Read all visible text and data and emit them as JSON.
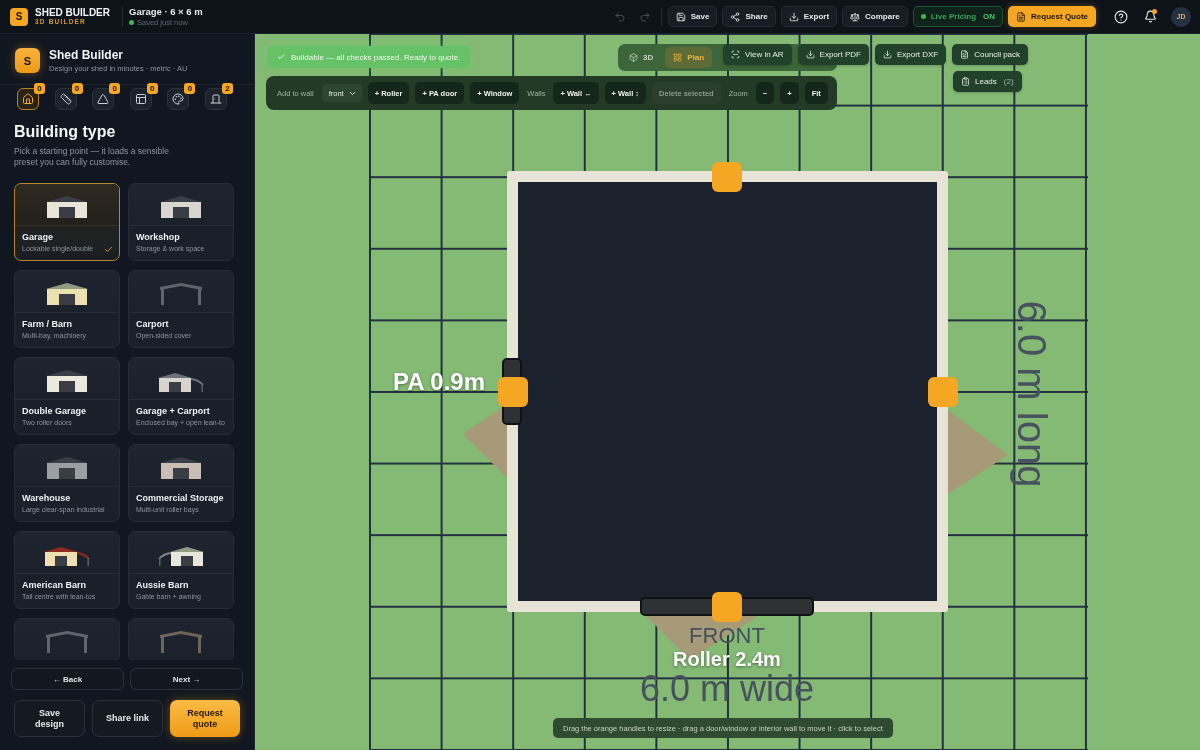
{
  "topbar": {
    "brand": {
      "logo_letter": "S",
      "name": "SHED BUILDER",
      "tagline": "3D BUILDER"
    },
    "project": {
      "title": "Garage · 6 × 6 m",
      "status": "Saved just now",
      "saved": true
    },
    "history": [
      {
        "kind": "undo",
        "disabled": true
      },
      {
        "kind": "redo",
        "disabled": true
      }
    ],
    "actions": [
      {
        "kind": "save",
        "label": "Save"
      },
      {
        "kind": "share",
        "label": "Share"
      },
      {
        "kind": "export",
        "label": "Export"
      },
      {
        "kind": "compare",
        "label": "Compare"
      }
    ],
    "live_pricing": {
      "label": "Live Pricing",
      "state": "ON",
      "on": true
    },
    "quote_button": {
      "label": "Request Quote"
    },
    "notifications": {
      "unread": true
    },
    "avatar": {
      "initials": "JD"
    }
  },
  "sidebar": {
    "logo_letter": "S",
    "title": "Shed Builder",
    "subtitle": "Design your shed in minutes · metric · AU",
    "steps": [
      {
        "kind": "home",
        "badge": "0",
        "selected": true
      },
      {
        "kind": "ruler",
        "badge": "0",
        "selected": false
      },
      {
        "kind": "triangle",
        "badge": "0",
        "selected": false
      },
      {
        "kind": "panel",
        "badge": "0",
        "selected": false
      },
      {
        "kind": "palette",
        "badge": "0",
        "selected": false
      },
      {
        "kind": "door",
        "badge": "2",
        "selected": false
      }
    ],
    "section_title": "Building type",
    "section_description": "Pick a starting point — it loads a sensible preset you can fully customise.",
    "building_types": [
      {
        "name": "Garage",
        "description": "Lockable single/double",
        "kind": "gable",
        "color": "#e8e4d8",
        "selected": true
      },
      {
        "name": "Workshop",
        "description": "Storage & work space",
        "kind": "gable",
        "color": "#d8d6cf",
        "selected": false
      },
      {
        "name": "Farm / Barn",
        "description": "Multi-bay, machinery",
        "kind": "farm",
        "color": "#ebe0b0",
        "selected": false
      },
      {
        "name": "Carport",
        "description": "Open-sided cover",
        "kind": "open",
        "color": "#60656c",
        "selected": false
      },
      {
        "name": "Double Garage",
        "description": "Two roller doors",
        "kind": "gable",
        "color": "#ebe8dd",
        "selected": false
      },
      {
        "name": "Garage + Carport",
        "description": "Enclosed bay + open lean-to",
        "kind": "leanto",
        "color": "#d6d4cc",
        "selected": false
      },
      {
        "name": "Warehouse",
        "description": "Large clear-span industrial",
        "kind": "gable",
        "color": "#9b9fa4",
        "selected": false
      },
      {
        "name": "Commercial Storage",
        "description": "Multi-unit roller bays",
        "kind": "gable",
        "color": "#c9beb5",
        "selected": false
      },
      {
        "name": "American Barn",
        "description": "Tall centre with lean-tos",
        "kind": "barn",
        "color": "#eedeb2",
        "selected": false
      },
      {
        "name": "Aussie Barn",
        "description": "Gable barn + awning",
        "kind": "awning",
        "color": "#e9e6dc",
        "selected": false
      },
      {
        "kind": "open",
        "color": "#60656c",
        "selected": false
      },
      {
        "kind": "open",
        "color": "#6e6458",
        "selected": false
      }
    ],
    "nav": [
      {
        "label": "← Back"
      },
      {
        "label": "Next →"
      }
    ],
    "footer_buttons": [
      {
        "label": "Save design",
        "kind": "secondary"
      },
      {
        "label": "Share link",
        "kind": "secondary"
      },
      {
        "label": "Request quote",
        "kind": "primary"
      }
    ]
  },
  "canvas": {
    "status": {
      "text": "Buildable — all checks passed. Ready to quote.",
      "ok": true
    },
    "view_modes": [
      {
        "kind": "cube",
        "label": "3D",
        "selected": false
      },
      {
        "kind": "grid",
        "label": "Plan",
        "selected": true
      }
    ],
    "export_buttons": [
      {
        "kind": "ar",
        "label": "View in AR"
      },
      {
        "kind": "pdf",
        "label": "Export PDF"
      },
      {
        "kind": "dxf",
        "label": "Export DXF"
      },
      {
        "kind": "document",
        "label": "Council pack"
      }
    ],
    "leads_button": {
      "label": "Leads",
      "count": "(2)"
    },
    "toolbar": [
      {
        "kind": "label",
        "text": "Add to wall"
      },
      {
        "kind": "select",
        "value": "front"
      },
      {
        "kind": "button",
        "text": "+ Roller",
        "disabled": false
      },
      {
        "kind": "button",
        "text": "+ PA door",
        "disabled": false
      },
      {
        "kind": "button",
        "text": "+ Window",
        "disabled": false
      },
      {
        "kind": "label",
        "text": "Walls"
      },
      {
        "kind": "button",
        "text": "+ Wall ↔",
        "disabled": false
      },
      {
        "kind": "button",
        "text": "+ Wall ↕",
        "disabled": false
      },
      {
        "kind": "button",
        "text": "Delete selected",
        "disabled": true
      },
      {
        "kind": "label",
        "text": "Zoom"
      },
      {
        "kind": "button",
        "text": "−",
        "disabled": false
      },
      {
        "kind": "button",
        "text": "+",
        "disabled": false
      },
      {
        "kind": "button",
        "text": "Fit",
        "disabled": false
      }
    ],
    "plan": {
      "wall_label": "FRONT",
      "openings": [
        {
          "kind": "door",
          "label": "PA 0.9m"
        },
        {
          "kind": "roller",
          "label": "Roller 2.4m"
        }
      ],
      "width_label": "6.0 m wide",
      "length_label": "6.0 m long"
    },
    "hint": "Drag the orange handles to resize · drag a door/window or interior wall to move it · click to select"
  }
}
